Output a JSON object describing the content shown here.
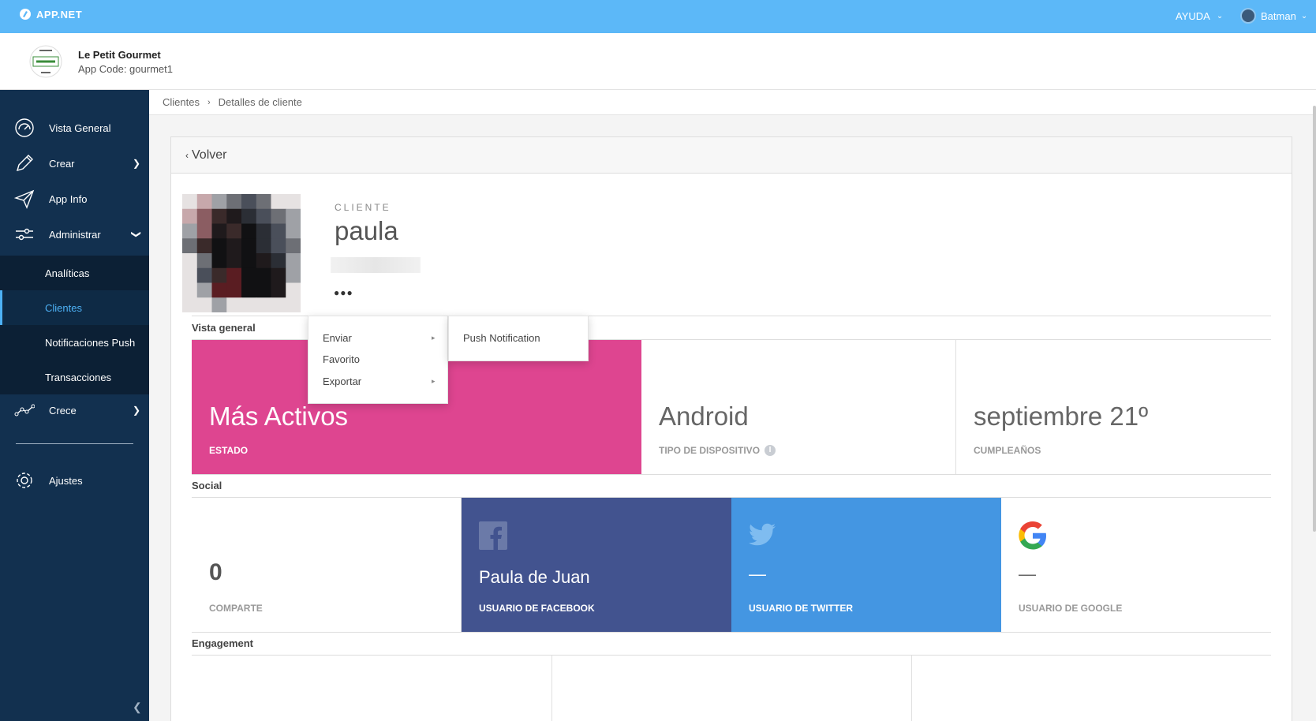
{
  "topbar": {
    "brand": "APP.NET",
    "help": "AYUDA",
    "user": "Batman"
  },
  "app": {
    "name": "Le Petit Gourmet",
    "code": "App Code: gourmet1"
  },
  "sidebar": {
    "items": [
      {
        "label": "Vista General",
        "icon": "speedometer-icon"
      },
      {
        "label": "Crear",
        "icon": "pencil-icon"
      },
      {
        "label": "App Info",
        "icon": "paper-plane-icon"
      },
      {
        "label": "Administrar",
        "icon": "sliders-icon"
      },
      {
        "label": "Crece",
        "icon": "growth-icon"
      },
      {
        "label": "Ajustes",
        "icon": "gear-icon"
      }
    ],
    "sub_items": [
      {
        "label": "Analíticas"
      },
      {
        "label": "Clientes"
      },
      {
        "label": "Notificaciones Push"
      },
      {
        "label": "Transacciones"
      }
    ]
  },
  "breadcrumb": {
    "root": "Clientes",
    "current": "Detalles de cliente"
  },
  "back_label": "Volver",
  "client": {
    "label": "CLIENTE",
    "name": "paula"
  },
  "menu": {
    "items": [
      "Enviar",
      "Favorito",
      "Exportar"
    ],
    "submenu": [
      "Push Notification"
    ]
  },
  "overview": {
    "title": "Vista general",
    "status_value": "Más Activos",
    "status_label": "ESTADO",
    "device_value": "Android",
    "device_label": "TIPO DE DISPOSITIVO",
    "birthday_value": "septiembre 21º",
    "birthday_label": "CUMPLEAÑOS"
  },
  "social": {
    "title": "Social",
    "shares_value": "0",
    "shares_label": "COMPARTE",
    "facebook_value": "Paula de Juan",
    "facebook_label": "USUARIO DE FACEBOOK",
    "twitter_value": "—",
    "twitter_label": "USUARIO DE TWITTER",
    "google_value": "—",
    "google_label": "USUARIO DE GOOGLE"
  },
  "engagement": {
    "title": "Engagement"
  },
  "colors": {
    "topbar": "#5cb8f8",
    "sidebar": "#12304f",
    "active": "#4db1f5",
    "status_tile": "#de4590",
    "facebook": "#42538f",
    "twitter": "#4496e2"
  }
}
